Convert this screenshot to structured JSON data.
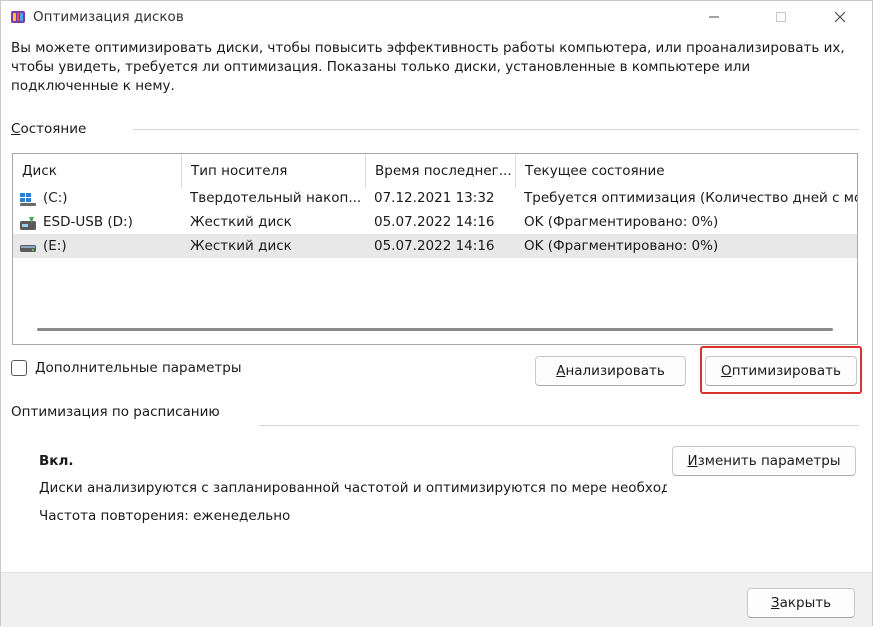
{
  "window": {
    "title": "Оптимизация дисков"
  },
  "intro_text": "Вы можете оптимизировать диски, чтобы повысить эффективность работы  компьютера, или проанализировать их, чтобы увидеть, требуется ли оптимизация. Показаны только диски, установленные в компьютере или подключенные к нему.",
  "status_section": {
    "label_underlined": "С",
    "label_rest": "остояние"
  },
  "columns": [
    "Диск",
    "Тип носителя",
    "Время последнег...",
    "Текущее состояние"
  ],
  "drives": [
    {
      "name": "(C:)",
      "media": "Твердотельный накоп...",
      "last_run": "07.12.2021 13:32",
      "status": "Требуется оптимизация (Количество дней с мо...",
      "icon": "windows-drive-icon",
      "selected": false
    },
    {
      "name": "ESD-USB (D:)",
      "media": "Жесткий диск",
      "last_run": "05.07.2022 14:16",
      "status": "OK (Фрагментировано: 0%)",
      "icon": "usb-drive-icon",
      "selected": false
    },
    {
      "name": "(E:)",
      "media": "Жесткий диск",
      "last_run": "05.07.2022 14:16",
      "status": "OK (Фрагментировано: 0%)",
      "icon": "drive-icon",
      "selected": true
    }
  ],
  "advanced_checkbox": {
    "label_underlined": "Д",
    "label_rest": "ополнительные параметры",
    "checked": false
  },
  "buttons": {
    "analyze_underlined": "А",
    "analyze_rest": "нализировать",
    "optimize_underlined": "О",
    "optimize_rest": "птимизировать",
    "change_underlined": "И",
    "change_rest": "зменить параметры",
    "close_underlined": "З",
    "close_rest": "акрыть"
  },
  "schedule": {
    "label": "Оптимизация по расписанию",
    "state": "Вкл.",
    "description": "Диски анализируются с запланированной частотой и оптимизируются по мере необход...",
    "frequency": "Частота повторения: еженедельно"
  },
  "colors": {
    "highlight": "#d9322c",
    "selected_row": "#e8e8e8"
  }
}
